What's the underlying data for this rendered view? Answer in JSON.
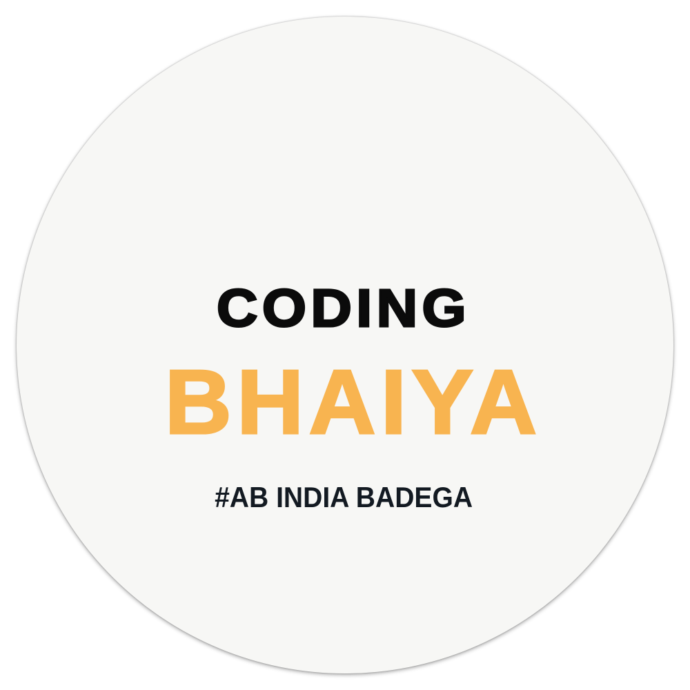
{
  "logo": {
    "line1": "CODING",
    "line2": "BHAIYA",
    "tagline": "#AB INDIA BADEGA"
  },
  "colors": {
    "accent": "#f8b450",
    "text_dark": "#0b0b0b",
    "tagline": "#131a22",
    "badge_fill": "#f7f7f5"
  }
}
